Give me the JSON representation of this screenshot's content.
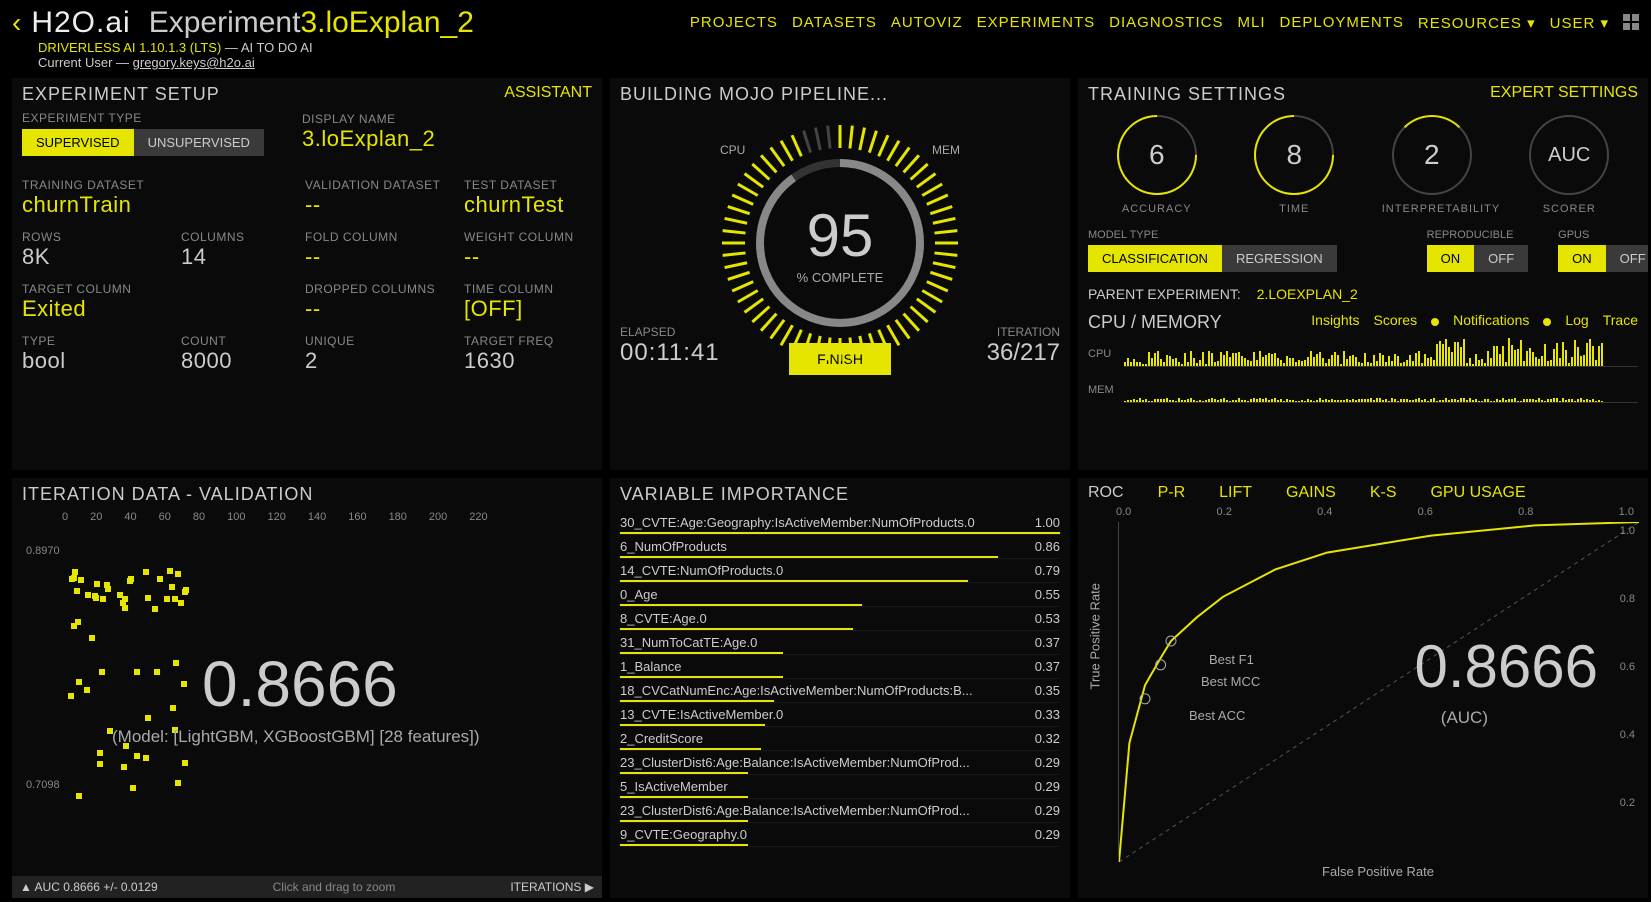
{
  "header": {
    "back": "‹",
    "logo": "H2O.ai",
    "title_prefix": "Experiment ",
    "title_name": "3.loExplan_2",
    "nav": [
      "PROJECTS",
      "DATASETS",
      "AUTOVIZ",
      "EXPERIMENTS",
      "DIAGNOSTICS",
      "MLI",
      "DEPLOYMENTS",
      "RESOURCES ▾",
      "USER ▾"
    ],
    "version": "DRIVERLESS AI 1.10.1.3 (LTS)",
    "tagline": " — AI TO DO AI",
    "current_user_label": "Current User — ",
    "current_user": "gregory.keys@h2o.ai"
  },
  "setup": {
    "title": "EXPERIMENT SETUP",
    "assistant": "ASSISTANT",
    "exp_type_label": "EXPERIMENT TYPE",
    "supervised": "SUPERVISED",
    "unsupervised": "UNSUPERVISED",
    "display_name_label": "DISPLAY NAME",
    "display_name": "3.loExplan_2",
    "training_dataset_label": "TRAINING DATASET",
    "training_dataset": "churnTrain",
    "validation_dataset_label": "VALIDATION DATASET",
    "validation_dataset": "--",
    "test_dataset_label": "TEST DATASET",
    "test_dataset": "churnTest",
    "rows_label": "ROWS",
    "rows": "8K",
    "columns_label": "COLUMNS",
    "columns": "14",
    "fold_label": "FOLD COLUMN",
    "fold": "--",
    "weight_label": "WEIGHT COLUMN",
    "weight": "--",
    "target_label": "TARGET COLUMN",
    "target": "Exited",
    "dropped_label": "DROPPED COLUMNS",
    "dropped": "--",
    "time_label": "TIME COLUMN",
    "time": "[OFF]",
    "type_label": "TYPE",
    "type": "bool",
    "count_label": "COUNT",
    "count": "8000",
    "unique_label": "UNIQUE",
    "unique": "2",
    "tfreq_label": "TARGET FREQ",
    "tfreq": "1630"
  },
  "progress": {
    "title": "BUILDING MOJO PIPELINE...",
    "cpu": "CPU",
    "mem": "MEM",
    "percent": "95",
    "percent_label": "% COMPLETE",
    "elapsed_label": "ELAPSED",
    "elapsed": "00:11:41",
    "finish": "FINISH",
    "iteration_label": "ITERATION",
    "iteration": "36/217"
  },
  "training": {
    "title": "TRAINING SETTINGS",
    "expert": "EXPERT SETTINGS",
    "dials": [
      {
        "val": "6",
        "label": "ACCURACY"
      },
      {
        "val": "8",
        "label": "TIME"
      },
      {
        "val": "2",
        "label": "INTERPRETABILITY"
      },
      {
        "val": "AUC",
        "label": "SCORER"
      }
    ],
    "model_type_label": "MODEL TYPE",
    "classification": "CLASSIFICATION",
    "regression": "REGRESSION",
    "reproducible_label": "REPRODUCIBLE",
    "on": "ON",
    "off": "OFF",
    "gpus_label": "GPUS",
    "parent_label": "PARENT EXPERIMENT:",
    "parent": "2.LOEXPLAN_2",
    "cpu_mem_title": "CPU / MEMORY",
    "tabs": [
      "Insights",
      "Scores",
      "Notifications",
      "Log",
      "Trace"
    ],
    "cpu_label": "CPU",
    "mem_label": "MEM"
  },
  "iteration": {
    "title": "ITERATION DATA - VALIDATION",
    "x_ticks": [
      "0",
      "20",
      "40",
      "60",
      "80",
      "100",
      "120",
      "140",
      "160",
      "180",
      "200",
      "220"
    ],
    "y_max": "0.8970",
    "y_min": "0.7098",
    "score": "0.8666",
    "model": "(Model: [LightGBM, XGBoostGBM] [28 features])",
    "footer_auc": "▲ AUC 0.8666 +/- 0.0129",
    "footer_hint": "Click and drag to zoom",
    "footer_iter": "ITERATIONS ▶"
  },
  "vi": {
    "title": "VARIABLE IMPORTANCE",
    "items": [
      {
        "name": "30_CVTE:Age:Geography:IsActiveMember:NumOfProducts.0",
        "val": "1.00",
        "pct": 100
      },
      {
        "name": "6_NumOfProducts",
        "val": "0.86",
        "pct": 86
      },
      {
        "name": "14_CVTE:NumOfProducts.0",
        "val": "0.79",
        "pct": 79
      },
      {
        "name": "0_Age",
        "val": "0.55",
        "pct": 55
      },
      {
        "name": "8_CVTE:Age.0",
        "val": "0.53",
        "pct": 53
      },
      {
        "name": "31_NumToCatTE:Age.0",
        "val": "0.37",
        "pct": 37
      },
      {
        "name": "1_Balance",
        "val": "0.37",
        "pct": 37
      },
      {
        "name": "18_CVCatNumEnc:Age:IsActiveMember:NumOfProducts:B...",
        "val": "0.35",
        "pct": 35
      },
      {
        "name": "13_CVTE:IsActiveMember.0",
        "val": "0.33",
        "pct": 33
      },
      {
        "name": "2_CreditScore",
        "val": "0.32",
        "pct": 32
      },
      {
        "name": "23_ClusterDist6:Age:Balance:IsActiveMember:NumOfProd...",
        "val": "0.29",
        "pct": 29
      },
      {
        "name": "5_IsActiveMember",
        "val": "0.29",
        "pct": 29
      },
      {
        "name": "23_ClusterDist6:Age:Balance:IsActiveMember:NumOfProd...",
        "val": "0.29",
        "pct": 29
      },
      {
        "name": "9_CVTE:Geography.0",
        "val": "0.29",
        "pct": 29
      }
    ]
  },
  "roc": {
    "tabs": [
      "ROC",
      "P-R",
      "LIFT",
      "GAINS",
      "K-S",
      "GPU USAGE"
    ],
    "active_tab": 0,
    "x_ticks": [
      "0.0",
      "0.2",
      "0.4",
      "0.6",
      "0.8",
      "1.0"
    ],
    "y_ticks": [
      "1.0",
      "0.8",
      "0.6",
      "0.4",
      "0.2"
    ],
    "score": "0.8666",
    "auc_label": "(AUC)",
    "xlabel": "False Positive Rate",
    "ylabel": "True Positive Rate",
    "annotations": [
      "Best F1",
      "Best MCC",
      "Best ACC"
    ]
  },
  "chart_data": {
    "roc_curve": {
      "type": "line",
      "title": "ROC",
      "xlabel": "False Positive Rate",
      "ylabel": "True Positive Rate",
      "xlim": [
        0,
        1
      ],
      "ylim": [
        0,
        1
      ],
      "x": [
        0,
        0.02,
        0.05,
        0.08,
        0.1,
        0.15,
        0.2,
        0.3,
        0.4,
        0.6,
        0.8,
        1.0
      ],
      "y": [
        0,
        0.35,
        0.52,
        0.6,
        0.65,
        0.72,
        0.78,
        0.86,
        0.91,
        0.96,
        0.99,
        1.0
      ],
      "auc": 0.8666,
      "markers": [
        {
          "label": "Best F1",
          "x": 0.1,
          "y": 0.65
        },
        {
          "label": "Best MCC",
          "x": 0.08,
          "y": 0.58
        },
        {
          "label": "Best ACC",
          "x": 0.05,
          "y": 0.48
        }
      ]
    },
    "iteration_validation": {
      "type": "scatter",
      "xlabel": "Iteration",
      "ylabel": "AUC",
      "xlim": [
        0,
        220
      ],
      "ylim": [
        0.7098,
        0.897
      ],
      "current_score": 0.8666,
      "auc_mean": 0.8666,
      "auc_std": 0.0129
    },
    "variable_importance": {
      "type": "bar",
      "categories": [
        "30_CVTE:Age:Geography:IsActiveMember:NumOfProducts.0",
        "6_NumOfProducts",
        "14_CVTE:NumOfProducts.0",
        "0_Age",
        "8_CVTE:Age.0",
        "31_NumToCatTE:Age.0",
        "1_Balance",
        "18_CVCatNumEnc:Age:IsActiveMember:NumOfProducts:B...",
        "13_CVTE:IsActiveMember.0",
        "2_CreditScore",
        "23_ClusterDist6:Age:Balance:IsActiveMember:NumOfProd...",
        "5_IsActiveMember",
        "23_ClusterDist6:Age:Balance:IsActiveMember:NumOfProd...",
        "9_CVTE:Geography.0"
      ],
      "values": [
        1.0,
        0.86,
        0.79,
        0.55,
        0.53,
        0.37,
        0.37,
        0.35,
        0.33,
        0.32,
        0.29,
        0.29,
        0.29,
        0.29
      ]
    }
  }
}
